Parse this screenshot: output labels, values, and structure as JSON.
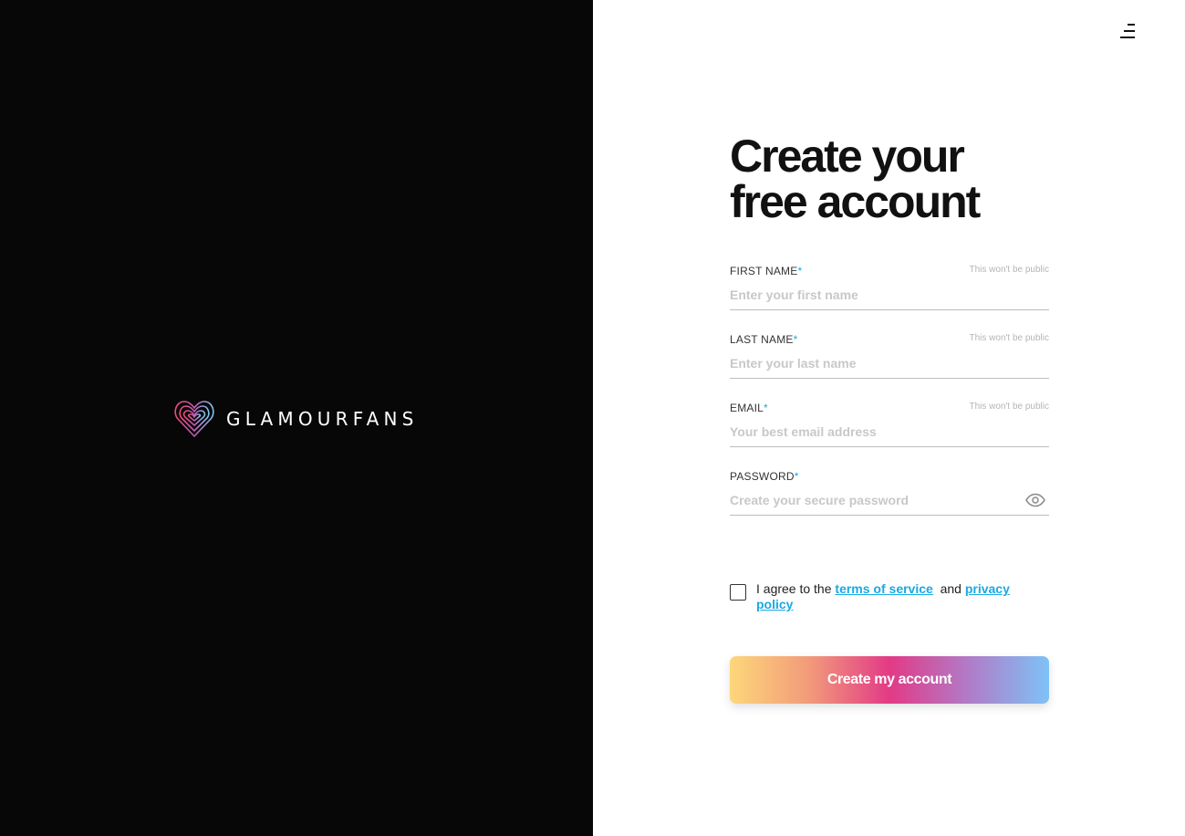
{
  "brand": {
    "name": "GLAMOURFANS"
  },
  "header": {
    "menu_icon": "hamburger-menu-icon"
  },
  "form": {
    "heading_line1": "Create your",
    "heading_line2": "free account",
    "required_mark": "*",
    "fields": [
      {
        "label": "FIRST NAME",
        "note": "This won't be public",
        "placeholder": "Enter your first name",
        "value": ""
      },
      {
        "label": "LAST NAME",
        "note": "This won't be public",
        "placeholder": "Enter your last name",
        "value": ""
      },
      {
        "label": "EMAIL",
        "note": "This won't be public",
        "placeholder": "Your best email address",
        "value": ""
      },
      {
        "label": "PASSWORD",
        "placeholder": "Create your secure password",
        "value": "",
        "icon": "eye-icon"
      }
    ],
    "agree": {
      "prefix": "I agree to the",
      "terms_link": "terms of service",
      "and": "and",
      "privacy_link": "privacy policy",
      "checked": false
    },
    "submit_label": "Create my account"
  },
  "colors": {
    "left_background": "#070707",
    "accent": "#19a9e3",
    "gradient": [
      "#fdd77a",
      "#f29a7a",
      "#e23a86",
      "#b07cc8",
      "#7ec2f6"
    ]
  }
}
